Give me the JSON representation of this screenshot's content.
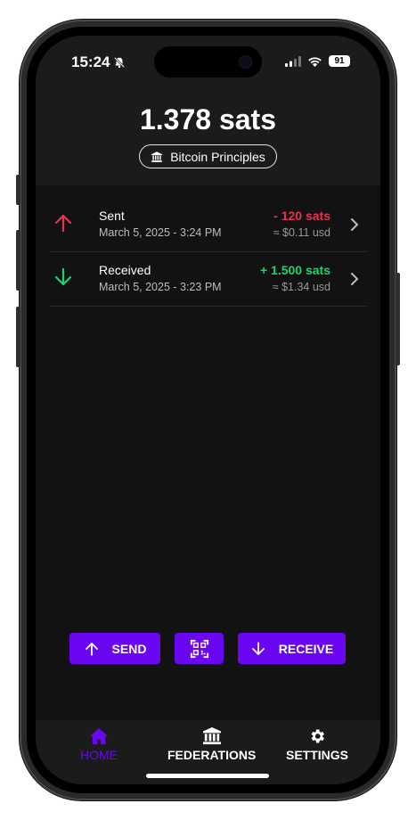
{
  "status_bar": {
    "time": "15:24",
    "battery": "91"
  },
  "header": {
    "balance": "1.378 sats",
    "federation": "Bitcoin Principles"
  },
  "transactions": [
    {
      "title": "Sent",
      "date": "March 5, 2025 - 3:24 PM",
      "amount": "- 120 sats",
      "fiat": "≈ $0.11 usd",
      "direction": "out",
      "color": "#e8344e"
    },
    {
      "title": "Received",
      "date": "March 5, 2025 - 3:23 PM",
      "amount": "+ 1.500 sats",
      "fiat": "≈ $1.34 usd",
      "direction": "in",
      "color": "#1fd36a"
    }
  ],
  "actions": {
    "send": "SEND",
    "receive": "RECEIVE"
  },
  "tabs": [
    {
      "label": "HOME",
      "icon": "home-icon",
      "active": true
    },
    {
      "label": "FEDERATIONS",
      "icon": "federation-icon",
      "active": false
    },
    {
      "label": "SETTINGS",
      "icon": "gear-icon",
      "active": false
    }
  ],
  "colors": {
    "accent": "#6b06f2",
    "sent": "#e8344e",
    "received": "#1fd36a",
    "background": "#121212"
  }
}
